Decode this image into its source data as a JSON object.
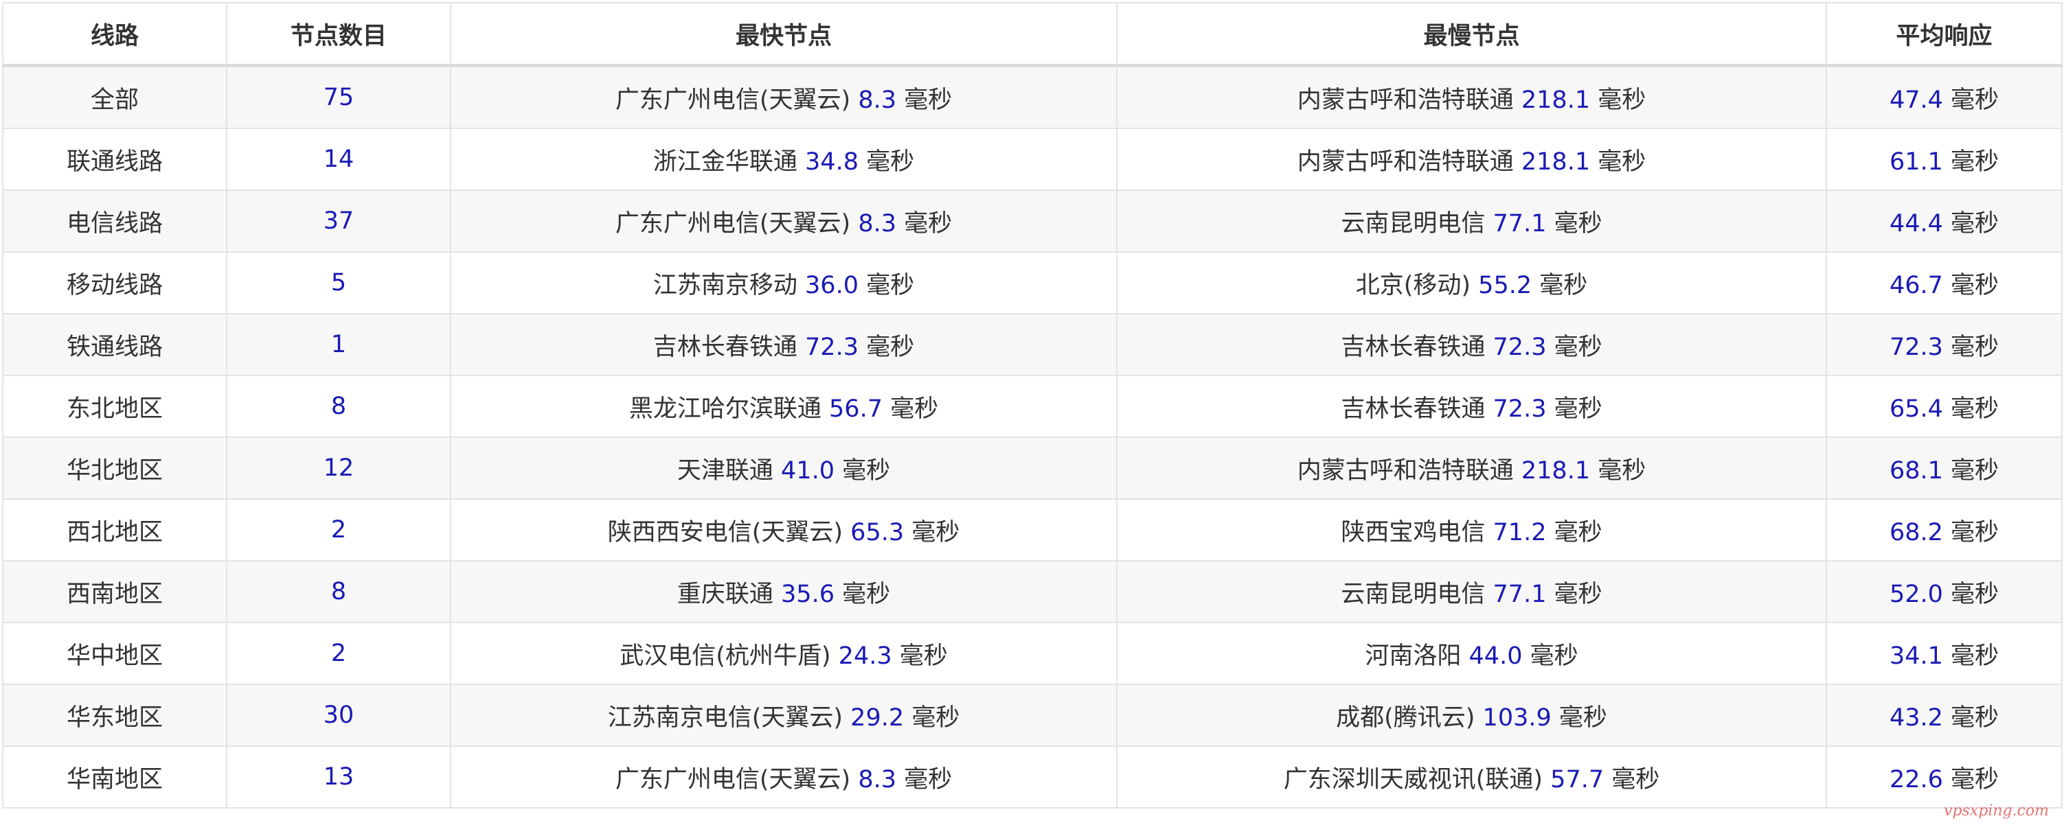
{
  "headers": [
    "线路",
    "节点数目",
    "最快节点",
    "最慢节点",
    "平均响应"
  ],
  "unit": "毫秒",
  "rows": [
    {
      "route": "全部",
      "count": "75",
      "fast_name": "广东广州电信(天翼云)",
      "fast_val": "8.3",
      "slow_name": "内蒙古呼和浩特联通",
      "slow_val": "218.1",
      "avg": "47.4"
    },
    {
      "route": "联通线路",
      "count": "14",
      "fast_name": "浙江金华联通",
      "fast_val": "34.8",
      "slow_name": "内蒙古呼和浩特联通",
      "slow_val": "218.1",
      "avg": "61.1"
    },
    {
      "route": "电信线路",
      "count": "37",
      "fast_name": "广东广州电信(天翼云)",
      "fast_val": "8.3",
      "slow_name": "云南昆明电信",
      "slow_val": "77.1",
      "avg": "44.4"
    },
    {
      "route": "移动线路",
      "count": "5",
      "fast_name": "江苏南京移动",
      "fast_val": "36.0",
      "slow_name": "北京(移动)",
      "slow_val": "55.2",
      "avg": "46.7"
    },
    {
      "route": "铁通线路",
      "count": "1",
      "fast_name": "吉林长春铁通",
      "fast_val": "72.3",
      "slow_name": "吉林长春铁通",
      "slow_val": "72.3",
      "avg": "72.3"
    },
    {
      "route": "东北地区",
      "count": "8",
      "fast_name": "黑龙江哈尔滨联通",
      "fast_val": "56.7",
      "slow_name": "吉林长春铁通",
      "slow_val": "72.3",
      "avg": "65.4"
    },
    {
      "route": "华北地区",
      "count": "12",
      "fast_name": "天津联通",
      "fast_val": "41.0",
      "slow_name": "内蒙古呼和浩特联通",
      "slow_val": "218.1",
      "avg": "68.1"
    },
    {
      "route": "西北地区",
      "count": "2",
      "fast_name": "陕西西安电信(天翼云)",
      "fast_val": "65.3",
      "slow_name": "陕西宝鸡电信",
      "slow_val": "71.2",
      "avg": "68.2"
    },
    {
      "route": "西南地区",
      "count": "8",
      "fast_name": "重庆联通",
      "fast_val": "35.6",
      "slow_name": "云南昆明电信",
      "slow_val": "77.1",
      "avg": "52.0"
    },
    {
      "route": "华中地区",
      "count": "2",
      "fast_name": "武汉电信(杭州牛盾)",
      "fast_val": "24.3",
      "slow_name": "河南洛阳",
      "slow_val": "44.0",
      "avg": "34.1"
    },
    {
      "route": "华东地区",
      "count": "30",
      "fast_name": "江苏南京电信(天翼云)",
      "fast_val": "29.2",
      "slow_name": "成都(腾讯云)",
      "slow_val": "103.9",
      "avg": "43.2"
    },
    {
      "route": "华南地区",
      "count": "13",
      "fast_name": "广东广州电信(天翼云)",
      "fast_val": "8.3",
      "slow_name": "广东深圳天威视讯(联通)",
      "slow_val": "57.7",
      "avg": "22.6"
    }
  ],
  "watermark": "vpsxping.com",
  "colors": {
    "number": "#1a1ab5",
    "text": "#333333",
    "stripe": "#f7f7f7",
    "border": "#e3e3e3"
  }
}
